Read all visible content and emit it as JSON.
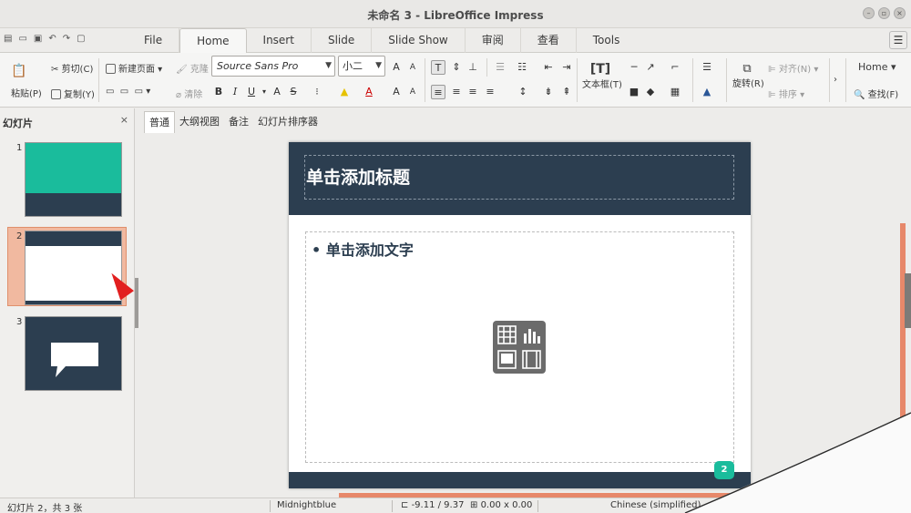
{
  "window": {
    "title": "未命名 3 - LibreOffice Impress",
    "controls": [
      "–",
      "▫",
      "×"
    ]
  },
  "quick_access": [
    "▤",
    "▭",
    "▣",
    "↶",
    "↷",
    "▢"
  ],
  "tabs": [
    {
      "label": "File"
    },
    {
      "label": "Home"
    },
    {
      "label": "Insert"
    },
    {
      "label": "Slide"
    },
    {
      "label": "Slide Show"
    },
    {
      "label": "审阅"
    },
    {
      "label": "查看"
    },
    {
      "label": "Tools"
    }
  ],
  "active_tab": "Home",
  "menu_button": "☰",
  "ribbon": {
    "paste": "粘贴(P)",
    "cut": "剪切(C)",
    "copy": "复制(Y)",
    "new_page": "新建页面",
    "clone": "克隆",
    "clear": "清除",
    "font_name": "Source Sans Pro",
    "font_size": "小二",
    "textbox": "文本框(T)",
    "rotate": "旋转(R)",
    "align": "对齐(N)",
    "arrange": "排序",
    "home_label": "Home",
    "find": "查找(F)",
    "bold": "B",
    "italic": "I",
    "underline": "U",
    "shadow": "A",
    "strike": "S",
    "grow": "A",
    "shrink": "A"
  },
  "slides_pane": {
    "title": "幻灯片",
    "close": "×",
    "slides": [
      {
        "number": "1"
      },
      {
        "number": "2"
      },
      {
        "number": "3"
      }
    ],
    "selected": 2
  },
  "view_tabs": [
    {
      "label": "普通"
    },
    {
      "label": "大纲视图"
    },
    {
      "label": "备注"
    },
    {
      "label": "幻灯片排序器"
    }
  ],
  "slide": {
    "title_placeholder": "单击添加标题",
    "content_placeholder": "单击添加文字",
    "bullet": "•",
    "page_number": "2"
  },
  "status": {
    "slide_info": "幻灯片 2，共 3 张",
    "master": "Midnightblue",
    "position": "-9.11 / 9.37",
    "size": "0.00 x 0.00",
    "language": "Chinese (simplified)"
  },
  "colors": {
    "theme_dark": "#2c3e50",
    "theme_teal": "#1abc9c",
    "accent": "#e7886a"
  }
}
